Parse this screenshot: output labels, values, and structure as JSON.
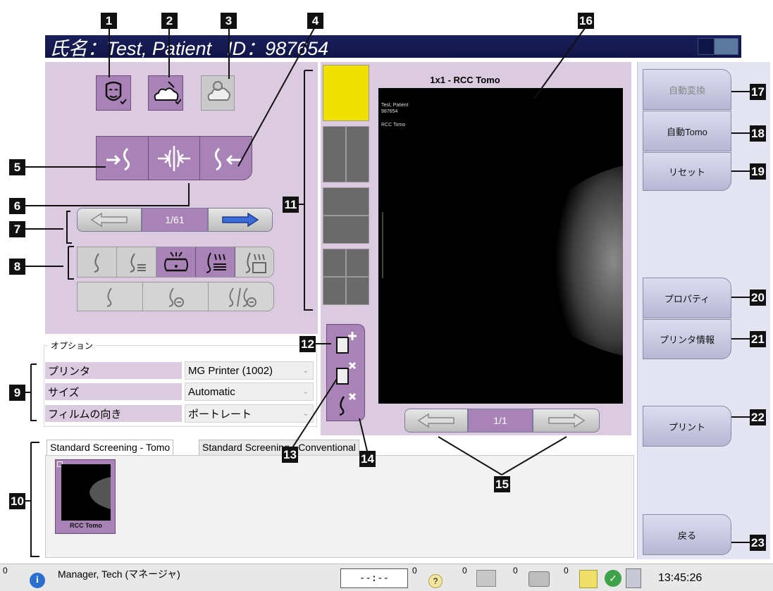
{
  "title_bar": {
    "patient_name": "氏名：Test, Patient",
    "patient_id": "ID：987654"
  },
  "callouts": [
    "1",
    "2",
    "3",
    "4",
    "5",
    "6",
    "7",
    "8",
    "9",
    "10",
    "11",
    "12",
    "13",
    "14",
    "15",
    "16",
    "17",
    "18",
    "19",
    "20",
    "21",
    "22",
    "23"
  ],
  "image_navigation": {
    "counter": "1/61"
  },
  "options": {
    "section_label": "オプション",
    "printer_label": "プリンタ",
    "printer_value": "MG Printer (1002)",
    "size_label": "サイズ",
    "size_value": "Automatic",
    "orientation_label": "フィルムの向き",
    "orientation_value": "ポートレート"
  },
  "tabs": [
    "Standard Screening - Tomo",
    "Standard Screening - Conventional"
  ],
  "thumbnail": {
    "label": "RCC Tomo"
  },
  "preview": {
    "title": "1x1 - RCC Tomo",
    "counter": "1/1",
    "overlay_lines": [
      "Test, Patient",
      "987654",
      "RCC Tomo"
    ]
  },
  "side_buttons": {
    "auto_convert": "自動変換",
    "auto_tomo": "自動Tomo",
    "reset": "リセット",
    "properties": "プロパティ",
    "printer_info": "プリンタ情報",
    "print": "プリント",
    "back": "戻る"
  },
  "status_bar": {
    "count_left": "0",
    "user": "Manager, Tech (マネージャ)",
    "clock_display": "--:--",
    "count_1": "0",
    "count_2": "0",
    "count_3": "0",
    "count_4": "0",
    "time": "13:45:26"
  },
  "colors": {
    "accent_purple": "#a983b7",
    "panel_lavender": "#dccbe0",
    "title_navy": "#1a1f5c",
    "nav_blue": "#3a6bd8",
    "highlight_yellow": "#f0e000"
  }
}
